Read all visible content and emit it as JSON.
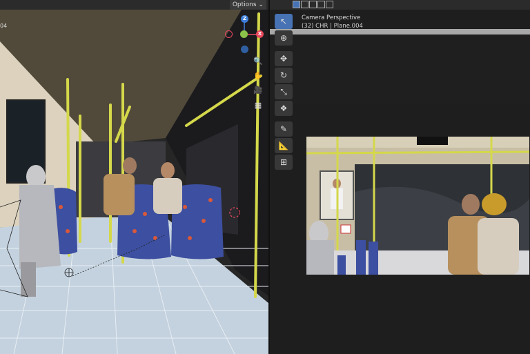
{
  "viewport_left": {
    "header": {
      "options_label": "Options",
      "options_chevron": "chevron-down-icon"
    },
    "edge_label": "04",
    "gizmo": {
      "z": "Z",
      "x": "X",
      "y": "Y",
      "colors": {
        "x": "#e84a5f",
        "y": "#8bc34a",
        "z": "#3f7fdb"
      }
    },
    "nav_icons": [
      "zoom-icon",
      "pan-hand-icon",
      "camera-icon",
      "grid-icon"
    ]
  },
  "viewport_right": {
    "view_name": "Camera Perspective",
    "object_info": "(32) CHR | Plane.004",
    "header_icons": [
      "select-box-icon",
      "select-extend-icon",
      "select-subtract-icon",
      "select-invert-icon",
      "select-intersect-icon"
    ],
    "tools": [
      {
        "name": "select-box-icon",
        "glyph": "↖",
        "active": true
      },
      {
        "name": "cursor-icon",
        "glyph": "⊕",
        "active": false
      },
      {
        "name": "move-icon",
        "glyph": "✥",
        "active": false
      },
      {
        "name": "rotate-icon",
        "glyph": "↻",
        "active": false
      },
      {
        "name": "scale-icon",
        "glyph": "⤡",
        "active": false
      },
      {
        "name": "transform-icon",
        "glyph": "❖",
        "active": false
      },
      {
        "name": "annotate-icon",
        "glyph": "✎",
        "active": false
      },
      {
        "name": "measure-icon",
        "glyph": "📐",
        "active": false
      },
      {
        "name": "add-cube-icon",
        "glyph": "⊞",
        "active": false
      }
    ]
  }
}
